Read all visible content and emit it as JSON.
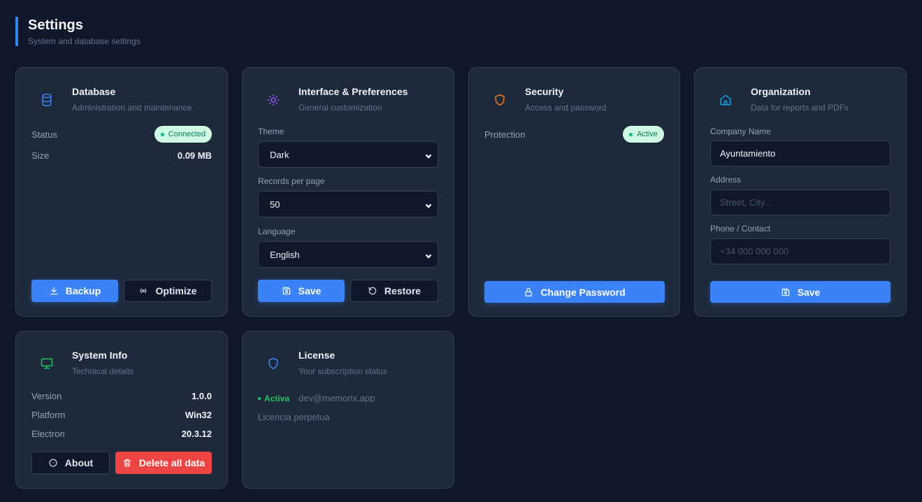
{
  "header": {
    "title": "Settings",
    "subtitle": "System and database settings"
  },
  "colors": {
    "background": "#0f172a",
    "card": "#1e293b",
    "accent": "#3b82f6",
    "success": "#22c55e",
    "danger": "#ef4444"
  },
  "database": {
    "icon": "database-icon",
    "title": "Database",
    "subtitle": "Administration and maintenance",
    "status_label": "Status",
    "status_value": "Connected",
    "size_label": "Size",
    "size_value": "0.09 MB",
    "backup_label": "Backup",
    "optimize_label": "Optimize"
  },
  "interface": {
    "icon": "sun-icon",
    "title": "Interface & Preferences",
    "subtitle": "General customization",
    "theme_label": "Theme",
    "theme_value": "Dark",
    "records_label": "Records per page",
    "records_value": "50",
    "language_label": "Language",
    "language_value": "English",
    "save_label": "Save",
    "restore_label": "Restore"
  },
  "security": {
    "icon": "shield-icon",
    "title": "Security",
    "subtitle": "Access and password",
    "protection_label": "Protection",
    "protection_value": "Active",
    "change_password_label": "Change Password"
  },
  "organization": {
    "icon": "home-icon",
    "title": "Organization",
    "subtitle": "Data for reports and PDFs",
    "company_label": "Company Name",
    "company_value": "Ayuntamiento",
    "address_label": "Address",
    "address_placeholder": "Street, City...",
    "phone_label": "Phone / Contact",
    "phone_placeholder": "+34 000 000 000",
    "save_label": "Save"
  },
  "system_info": {
    "icon": "monitor-icon",
    "title": "System Info",
    "subtitle": "Technical details",
    "version_label": "Version",
    "version_value": "1.0.0",
    "platform_label": "Platform",
    "platform_value": "Win32",
    "electron_label": "Electron",
    "electron_value": "20.3.12",
    "about_label": "About",
    "delete_label": "Delete all data"
  },
  "license": {
    "icon": "shield-icon",
    "title": "License",
    "subtitle": "Your subscription status",
    "status": "Activa",
    "email": "dev@memorix.app",
    "type": "Licencia perpetua"
  }
}
